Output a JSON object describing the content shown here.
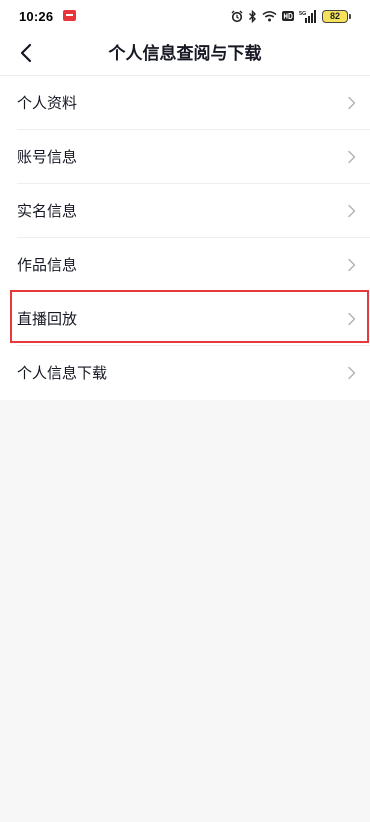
{
  "status_bar": {
    "time": "10:26",
    "battery": "82",
    "icons": [
      "notification-icon",
      "alarm-icon",
      "bluetooth-icon",
      "wifi-icon",
      "hd-icon",
      "signal-5g-icon",
      "battery-icon"
    ]
  },
  "nav": {
    "back_icon": "chevron-left-icon",
    "title": "个人信息查阅与下载"
  },
  "menu": {
    "items": [
      {
        "label": "个人资料"
      },
      {
        "label": "账号信息"
      },
      {
        "label": "实名信息"
      },
      {
        "label": "作品信息"
      },
      {
        "label": "直播回放",
        "highlighted": true
      },
      {
        "label": "个人信息下载"
      }
    ],
    "chevron_icon": "chevron-right-icon"
  },
  "colors": {
    "highlight": "#e63a3a",
    "text": "#161823",
    "chevron": "#b4b4b4",
    "background": "#f7f7f7"
  }
}
